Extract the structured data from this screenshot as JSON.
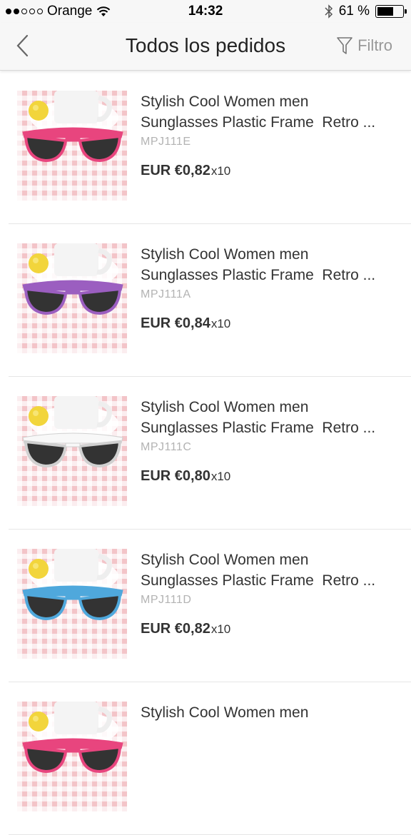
{
  "status_bar": {
    "carrier": "Orange",
    "time": "14:32",
    "battery": "61 %",
    "battery_level": 0.61
  },
  "nav": {
    "title": "Todos los pedidos",
    "filter_label": "Filtro"
  },
  "items": [
    {
      "title_line1": "Stylish Cool Women men",
      "title_line2": "Sunglasses Plastic Frame  Retro ...",
      "sku": "MPJ111E",
      "price": "EUR €0,82",
      "qty": "x10",
      "frame_color": "#e8457e"
    },
    {
      "title_line1": "Stylish Cool Women men",
      "title_line2": "Sunglasses Plastic Frame  Retro ...",
      "sku": "MPJ111A",
      "price": "EUR €0,84",
      "qty": "x10",
      "frame_color": "#9b5ec0"
    },
    {
      "title_line1": "Stylish Cool Women men",
      "title_line2": "Sunglasses Plastic Frame  Retro ...",
      "sku": "MPJ111C",
      "price": "EUR €0,80",
      "qty": "x10",
      "frame_color": "#f8f8f8"
    },
    {
      "title_line1": "Stylish Cool Women men",
      "title_line2": "Sunglasses Plastic Frame  Retro ...",
      "sku": "MPJ111D",
      "price": "EUR €0,82",
      "qty": "x10",
      "frame_color": "#4fa8dc"
    },
    {
      "title_line1": "Stylish Cool Women men",
      "title_line2": "",
      "sku": "",
      "price": "",
      "qty": "",
      "frame_color": "#e8457e"
    }
  ]
}
